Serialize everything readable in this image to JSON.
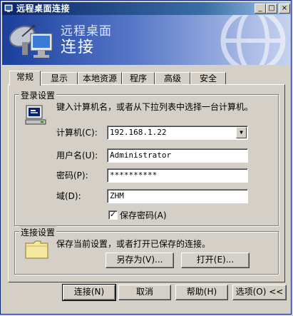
{
  "window": {
    "title": "远程桌面连接",
    "controls": {
      "minimize": "_",
      "maximize": "□",
      "close": "×"
    }
  },
  "banner": {
    "line1": "远程桌面",
    "line2": "连接"
  },
  "tabs": [
    {
      "label": "常规",
      "active": true
    },
    {
      "label": "显示",
      "active": false
    },
    {
      "label": "本地资源",
      "active": false
    },
    {
      "label": "程序",
      "active": false
    },
    {
      "label": "高级",
      "active": false
    },
    {
      "label": "安全",
      "active": false
    }
  ],
  "login": {
    "legend": "登录设置",
    "description": "键入计算机名，或者从下拉列表中选择一台计算机。",
    "computer_label": "计算机(C):",
    "computer_value": "192.168.1.22",
    "username_label": "用户名(U):",
    "username_value": "Administrator",
    "password_label": "密码(P):",
    "password_value": "**********",
    "domain_label": "域(D):",
    "domain_value": "ZHM",
    "save_password_label": "保存密码(A)",
    "save_password_checked": true
  },
  "connection": {
    "legend": "连接设置",
    "description": "保存当前设置，或者打开已保存的连接。",
    "save_as_label": "另存为(V)...",
    "open_label": "打开(E)..."
  },
  "footer": {
    "connect_label": "连接(N)",
    "cancel_label": "取消",
    "help_label": "帮助(H)",
    "options_label": "选项(O) <<"
  }
}
